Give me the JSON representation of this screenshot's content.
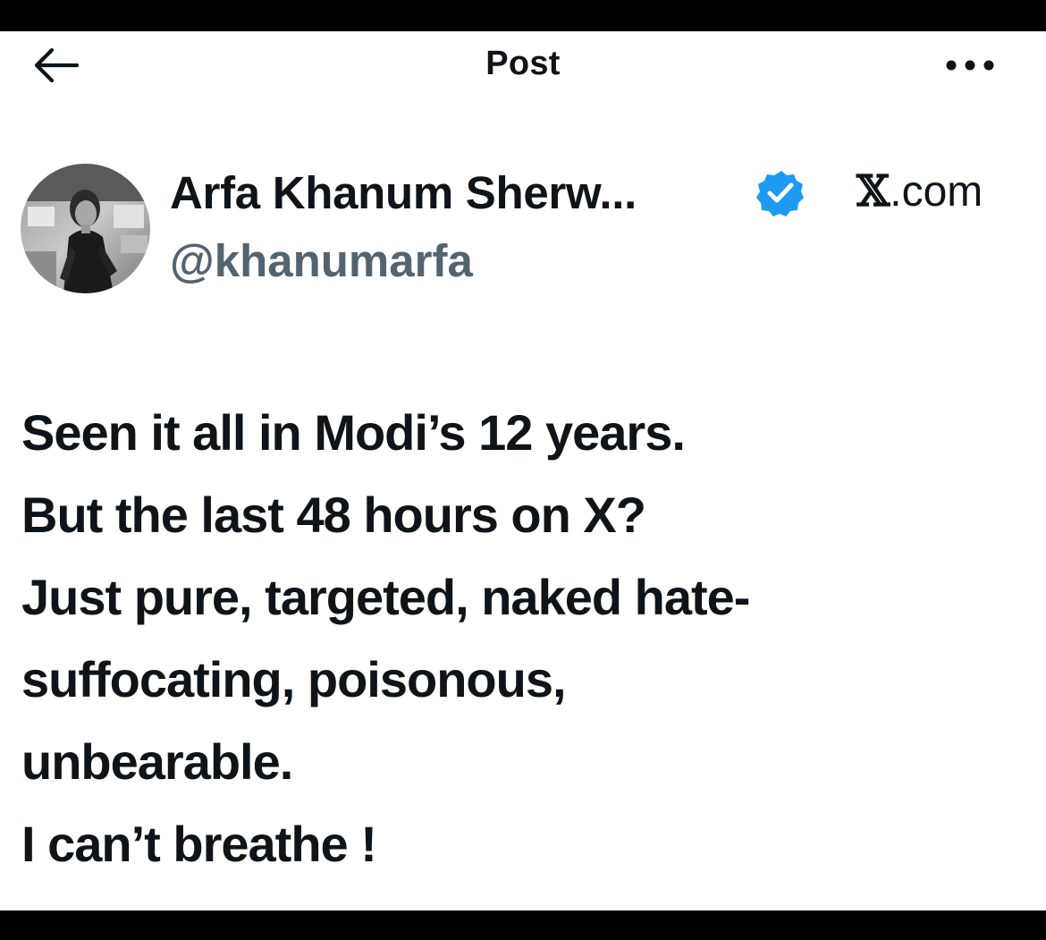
{
  "header": {
    "title": "Post",
    "back_icon": "arrow-left-icon",
    "more_icon": "more-horizontal-icon"
  },
  "author": {
    "display_name": "Arfa Khanum Sherw...",
    "handle": "@khanumarfa",
    "verified": true,
    "verified_color": "#1d9bf0"
  },
  "source": {
    "glyph": "𝕏",
    "text": ".com"
  },
  "post": {
    "lines": [
      "Seen it all in Modi’s 12 years.",
      "But the last 48 hours on X?",
      "Just pure, targeted, naked hate-",
      "suffocating, poisonous,",
      "unbearable.",
      "I can’t breathe !"
    ]
  },
  "colors": {
    "text": "#0f1419",
    "secondary_text": "#536471",
    "frame": "#000000",
    "background": "#ffffff"
  }
}
